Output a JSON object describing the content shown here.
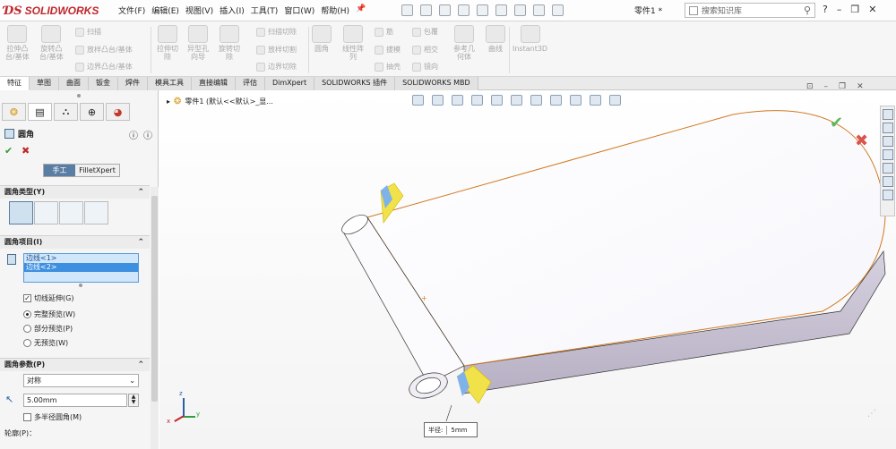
{
  "app": {
    "brand": "SOLIDWORKS",
    "brand_color": "#c0272d"
  },
  "menu": [
    "文件(F)",
    "编辑(E)",
    "视图(V)",
    "插入(I)",
    "工具(T)",
    "窗口(W)",
    "帮助(H)"
  ],
  "titlebar": {
    "part_name": "零件1 *",
    "search_placeholder": "搜索知识库",
    "help": "?"
  },
  "ribbon": {
    "big": [
      {
        "label": "拉伸凸\n台/基体",
        "icon": "extrude-boss-icon"
      },
      {
        "label": "旋转凸\n台/基体",
        "icon": "revolve-boss-icon"
      },
      {
        "label": "拉伸切\n除",
        "icon": "extrude-cut-icon"
      },
      {
        "label": "异型孔\n向导",
        "icon": "hole-wizard-icon"
      },
      {
        "label": "旋转切\n除",
        "icon": "revolve-cut-icon"
      },
      {
        "label": "圆角",
        "icon": "fillet-icon"
      },
      {
        "label": "线性阵\n列",
        "icon": "linear-pattern-icon"
      },
      {
        "label": "参考几\n何体",
        "icon": "reference-geometry-icon"
      },
      {
        "label": "曲线",
        "icon": "curves-icon"
      },
      {
        "label": "Instant3D",
        "icon": "instant3d-icon"
      }
    ],
    "small": {
      "sweep": "扫描",
      "loft": "放样凸台/基体",
      "boundary": "边界凸台/基体",
      "sweep_cut": "扫描切除",
      "loft_cut": "放样切割",
      "boundary_cut": "边界切除",
      "rib": "筋",
      "draft": "拔模",
      "shell": "抽壳",
      "wrap": "包覆",
      "intersect": "相交",
      "mirror": "镜向"
    }
  },
  "tabs": [
    "特征",
    "草图",
    "曲面",
    "钣金",
    "焊件",
    "模具工具",
    "直接编辑",
    "评估",
    "DimXpert",
    "SOLIDWORKS 插件",
    "SOLIDWORKS MBD"
  ],
  "panel": {
    "feature_title": "圆角",
    "mode_manual": "手工",
    "mode_filletxpert": "FilletXpert",
    "fillet_type": {
      "header": "圆角类型(Y)"
    },
    "fillet_items": {
      "header": "圆角项目(I)",
      "edges": [
        "边线<1>",
        "边线<2>"
      ]
    },
    "tangent_propagation": "切线延伸(G)",
    "preview": [
      {
        "label": "完整预览(W)",
        "selected": true
      },
      {
        "label": "部分预览(P)",
        "selected": false
      },
      {
        "label": "无预览(W)",
        "selected": false
      }
    ],
    "fillet_params": {
      "header": "圆角参数(P)",
      "method": "对称",
      "radius": "5.00mm",
      "multi_radius": "多半径圆角(M)",
      "profile": "轮廓(P)："
    }
  },
  "viewport": {
    "breadcrumb": "零件1 (默认<<默认>_显...",
    "callout_label": "半径:",
    "callout_value": "5mm",
    "accept_color": "#5cb85c",
    "cancel_color": "#d9534f",
    "axes": {
      "x": "x",
      "y": "y",
      "z": "z"
    }
  }
}
